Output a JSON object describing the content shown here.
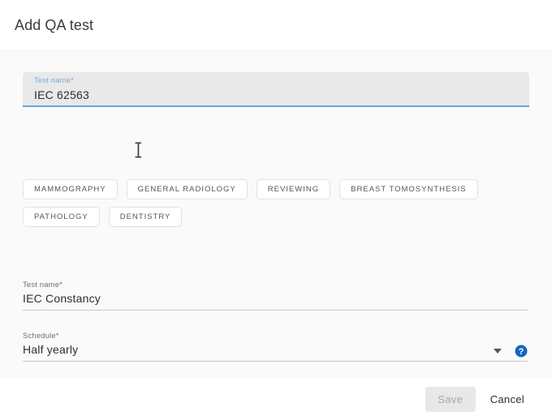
{
  "dialog": {
    "title": "Add QA test"
  },
  "form": {
    "test_name_focused": {
      "label": "Test name*",
      "value": "IEC 62563",
      "placeholder": "Test name"
    },
    "test_name_second": {
      "label": "Test name*",
      "value": "IEC Constancy",
      "placeholder": "Test name"
    },
    "schedule": {
      "label": "Schedule*",
      "value": "Half yearly",
      "caret_icon": "chevron-down-icon",
      "help_icon": "help-circle-icon",
      "options": [
        "Half yearly"
      ]
    }
  },
  "modality_chips": [
    {
      "label": "MAMMOGRAPHY"
    },
    {
      "label": "GENERAL RADIOLOGY"
    },
    {
      "label": "REVIEWING"
    },
    {
      "label": "BREAST TOMOSYNTHESIS"
    },
    {
      "label": "PATHOLOGY"
    },
    {
      "label": "DENTISTRY"
    }
  ],
  "footer": {
    "save_label": "Save",
    "cancel_label": "Cancel"
  },
  "colors": {
    "accent_blue": "#6ba3d6",
    "help_blue": "#1565c0",
    "body_bg": "#fafafa",
    "focused_field_bg": "#e9e9e9",
    "save_disabled_bg": "#e8e8e8"
  }
}
